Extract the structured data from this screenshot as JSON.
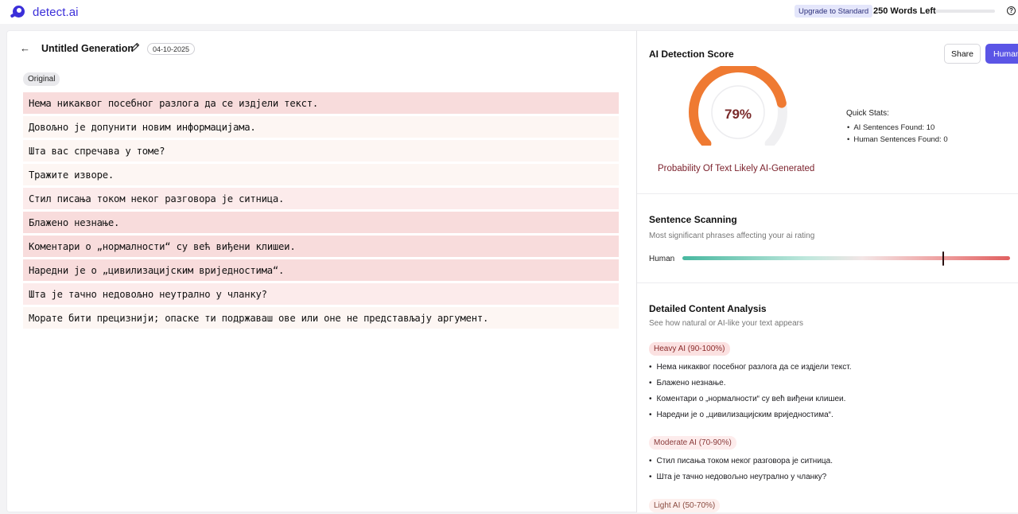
{
  "app": {
    "name": "detect.ai",
    "upgrade_label": "Upgrade to Standard",
    "words_left": "250 Words Left",
    "help_glyph": "?"
  },
  "document": {
    "title": "Untitled Generation",
    "date": "04-10-2025",
    "view_badge": "Original",
    "sentences": [
      {
        "text": "Нема никаквог посебног разлога да се издјели текст.",
        "level": "heavy"
      },
      {
        "text": "Довољно је допунити новим информацијама.",
        "level": "light"
      },
      {
        "text": "Шта вас спречава у томе?",
        "level": "light"
      },
      {
        "text": "Тражите изворе.",
        "level": "light"
      },
      {
        "text": "Стил писања током неког разговора је ситница.",
        "level": "moderate"
      },
      {
        "text": "Блажено незнање.",
        "level": "heavy"
      },
      {
        "text": "Коментари о „нормалности“ су већ виђени клишеи.",
        "level": "heavy"
      },
      {
        "text": "Наредни је о „цивилизацијским вриједностима“.",
        "level": "heavy"
      },
      {
        "text": "Шта је тачно недовољно неутрално у чланку?",
        "level": "moderate"
      },
      {
        "text": "Морате бити прецизнији; опаске ти подржаваш ове или оне не представљају аргумент.",
        "level": "light"
      }
    ]
  },
  "detection": {
    "title": "AI Detection Score",
    "share_label": "Share",
    "humanize_label": "Human",
    "score_percent": 79,
    "score_text": "79%",
    "probability_label": "Probability Of Text Likely AI-Generated",
    "quick_stats_title": "Quick Stats:",
    "quick_stats": [
      "AI Sentences Found: 10",
      "Human Sentences Found: 0"
    ]
  },
  "scanning": {
    "title": "Sentence Scanning",
    "subtitle": "Most significant phrases affecting your ai rating",
    "left_label": "Human",
    "marker_fraction": 0.795
  },
  "analysis": {
    "title": "Detailed Content Analysis",
    "subtitle": "See how natural or AI-like your text appears",
    "categories": [
      {
        "label": "Heavy AI (90-100%)",
        "items": [
          "Нема никаквог посебног разлога да се издјели текст.",
          "Блажено незнање.",
          "Коментари о „нормалности“ су већ виђени клишеи.",
          "Наредни је о „цивилизацијским вриједностима“."
        ]
      },
      {
        "label": "Moderate AI (70-90%)",
        "items": [
          "Стил писања током неког разговора је ситница.",
          "Шта је тачно недовољно неутрално у чланку?"
        ]
      },
      {
        "label": "Light AI (50-70%)",
        "items": []
      }
    ]
  },
  "colors": {
    "brand": "#3b2fd9",
    "gauge_fill": "#ef7a32",
    "gauge_track": "#f0f0f2",
    "heavy_bg": "#f8dcdc",
    "moderate_bg": "#fcebeb",
    "light_bg": "#fdf6f3"
  }
}
